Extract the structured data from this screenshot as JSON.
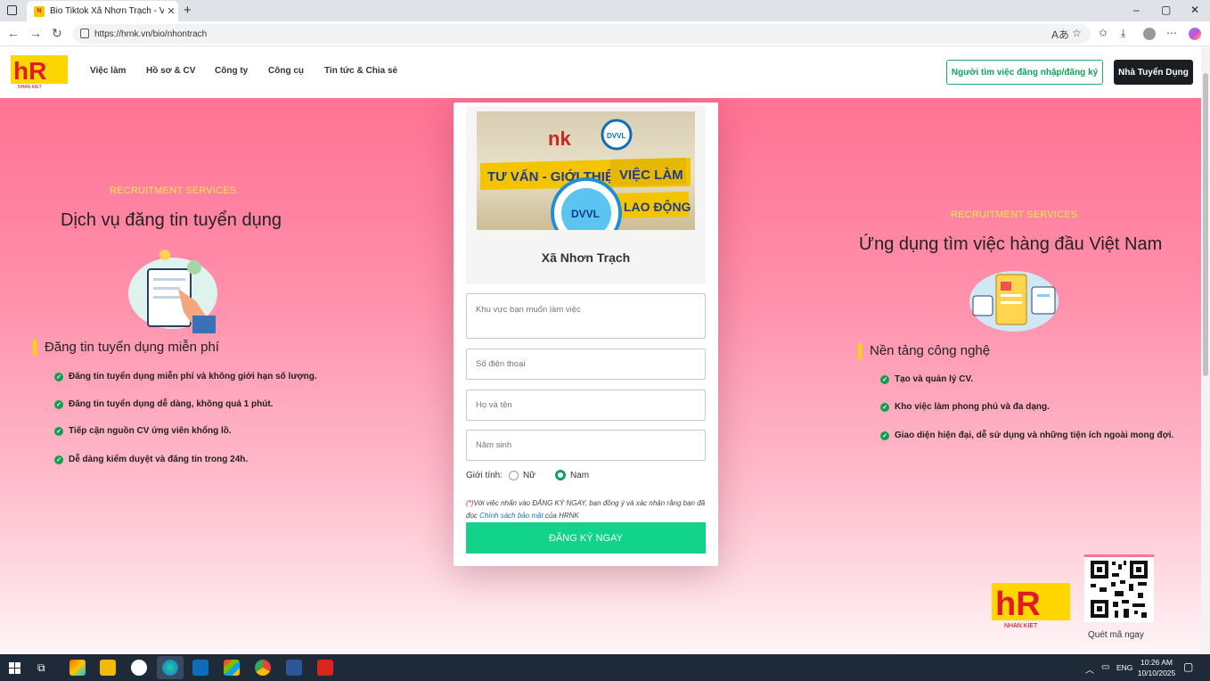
{
  "browser": {
    "tab_title": "Bio Tiktok Xã Nhơn Trạch - Việc là",
    "favicon_text": "N",
    "url": "https://hrnk.vn/bio/nhontrach",
    "minimize": "–",
    "maximize": "▢",
    "close": "✕"
  },
  "header": {
    "nav": [
      "Việc làm",
      "Hồ sơ & CV",
      "Công ty",
      "Công cụ",
      "Tin tức & Chia sẻ"
    ],
    "btn_seeker": "Người tìm việc đăng nhập/đăng ký",
    "btn_employer": "Nhà Tuyển Dụng"
  },
  "left": {
    "eyebrow": "RECRUITMENT SERVICES",
    "title": "Dịch vụ đăng tin tuyển dụng",
    "subtitle": "Đăng tin tuyển dụng miễn phí",
    "features": [
      "Đăng tin tuyển dụng miễn phí và không giới hạn số lượng.",
      "Đăng tin tuyển dụng dễ dàng, không quá 1 phút.",
      "Tiếp cận nguồn CV ứng viên khổng lồ.",
      "Dễ dàng kiểm duyệt và đăng tin trong 24h."
    ]
  },
  "right": {
    "eyebrow": "RECRUITMENT SERVICES",
    "title": "Ứng dụng tìm việc hàng đầu Việt Nam",
    "subtitle": "Nền tảng công nghệ",
    "features": [
      "Tạo và quản lý CV.",
      "Kho việc làm phong phú và đa dạng.",
      "Giao diện hiện đại, dễ sử dụng và những tiện ích ngoài mong đợi."
    ],
    "qr_label": "Quét mã ngay"
  },
  "form": {
    "banner_line1": "TƯ VẤN - GIỚI THIỆU",
    "banner_line1b": "VIỆC LÀM",
    "banner_line2": "LAO ĐỘNG",
    "badge": "DVVL",
    "commune": "Xã Nhơn Trạch",
    "area_placeholder": "Khu vực bạn muốn làm việc",
    "phone_placeholder": "Số điện thoại",
    "name_placeholder": "Họ và tên",
    "birth_placeholder": "Năm sinh",
    "gender_label": "Giới tính:",
    "gender_female": "Nữ",
    "gender_male": "Nam",
    "gender_selected": "Nam",
    "policy_req": "(*)",
    "policy_text": "Với việc nhấn vào ĐĂNG KÝ NGAY, bạn đồng ý và xác nhận rằng bạn đã đọc ",
    "policy_link": "Chính sách bảo mật",
    "policy_tail": " của HRNK",
    "submit": "ĐĂNG KÝ NGAY"
  },
  "taskbar": {
    "lang": "ENG",
    "time": "10:26 AM",
    "date": "10/10/2025"
  },
  "colors": {
    "accent_green": "#11d38a",
    "eyebrow_yellow": "#ffe94a",
    "pink": "#ff7293"
  }
}
